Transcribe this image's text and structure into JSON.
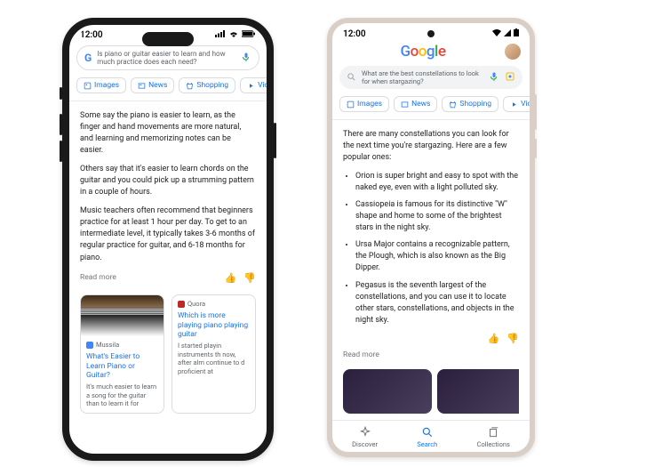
{
  "phone1": {
    "time": "12:00",
    "search_query": "Is piano or guitar easier to learn and how much practice does each need?",
    "chips": [
      "Images",
      "News",
      "Shopping",
      "Vide"
    ],
    "para1": "Some say the piano is easier to learn, as the finger and hand movements are more natural, and learning and memorizing notes can be easier.",
    "para2": "Others say that it's easier to learn chords on the guitar and you could pick up a strumming pattern in a couple of hours.",
    "para3": "Music teachers often recommend that beginners practice for at least 1 hour per day. To get to an intermediate level, it typically takes 3-6 months of regular practice for guitar, and 6-18 months for piano.",
    "readmore": "Read more",
    "card1": {
      "source": "Mussila",
      "title": "What's Easier to Learn Piano or Guitar?",
      "desc": "It's much easier to learn a song for the guitar than to learn it for"
    },
    "card2": {
      "source": "Quora",
      "title": "Which is more playing piano playing guitar",
      "desc": "I started playin instruments th now, after alm continue to d proficient at"
    }
  },
  "phone2": {
    "time": "12:00",
    "logo": "Google",
    "search_query": "What are the best constellations to look for when stargazing?",
    "chips": [
      "Images",
      "News",
      "Shopping",
      "Vide"
    ],
    "intro": "There are many constellations you can look for the next time you're stargazing. Here are a few popular ones:",
    "bullets": [
      "Orion is super bright and easy to spot with the naked eye, even with a light polluted sky.",
      "Cassiopeia is famous for its distinctive \"W\" shape and home to some of the brightest stars in the night sky.",
      "Ursa Major contains a recognizable pattern, the Plough, which is also known as the Big Dipper.",
      "Pegasus is the seventh largest of the constellations, and you can use it to locate other stars, constellations, and objects in the night sky."
    ],
    "readmore": "Read more",
    "nav": {
      "discover": "Discover",
      "search": "Search",
      "collections": "Collections"
    }
  }
}
